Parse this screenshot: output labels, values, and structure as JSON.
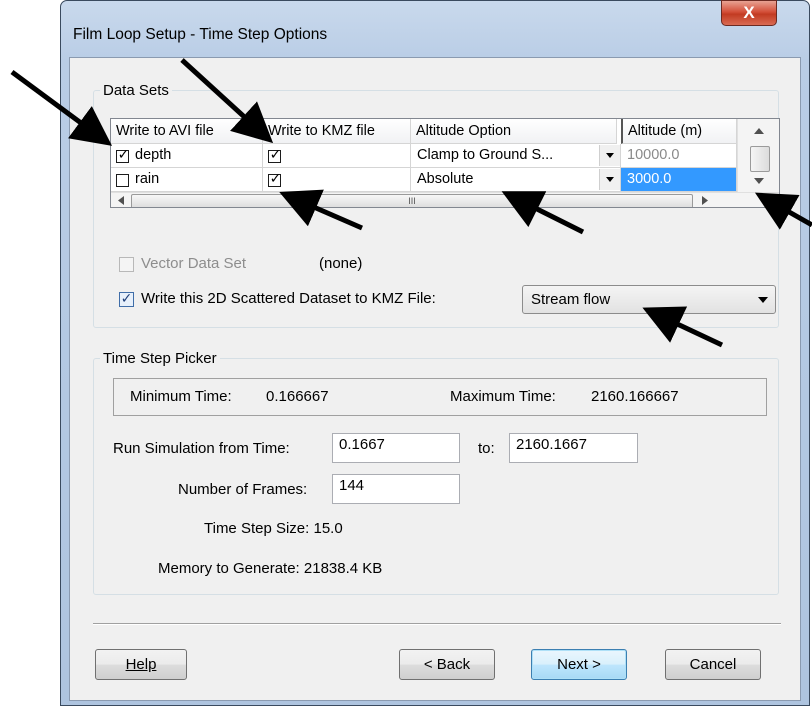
{
  "window": {
    "title": "Film Loop Setup - Time Step Options",
    "close_glyph": "X"
  },
  "data_sets": {
    "group_label": "Data Sets",
    "columns": [
      "Write to AVI file",
      "Write to KMZ file",
      "Altitude Option",
      "Altitude (m)"
    ],
    "rows": [
      {
        "avi_checked": true,
        "name": "depth",
        "kmz_checked": true,
        "altitude_option": "Clamp to Ground S...",
        "altitude": "10000.0"
      },
      {
        "avi_checked": false,
        "name": "rain",
        "kmz_checked": true,
        "altitude_option": "Absolute",
        "altitude": "3000.0"
      }
    ],
    "hscroll_grip": "III",
    "check_glyph": "✓"
  },
  "vector": {
    "label": "Vector Data Set",
    "value": "(none)"
  },
  "scattered": {
    "label": "Write this 2D Scattered Dataset to KMZ File:",
    "checked": true,
    "selected": "Stream flow"
  },
  "time_step": {
    "group_label": "Time Step Picker",
    "min_label": "Minimum Time:",
    "min_value": "0.166667",
    "max_label": "Maximum Time:",
    "max_value": "2160.166667",
    "run_from_label": "Run Simulation from Time:",
    "run_from_value": "0.1667",
    "to_label": "to:",
    "to_value": "2160.1667",
    "frames_label": "Number of Frames:",
    "frames_value": "144",
    "step_size_text": "Time Step Size: 15.0",
    "memory_text": "Memory to Generate: 21838.4 KB"
  },
  "buttons": {
    "help": "Help",
    "back": "< Back",
    "next": "Next >",
    "cancel": "Cancel"
  },
  "colors": {
    "selection": "#3399ff",
    "annotation_arrow": "#000000"
  }
}
